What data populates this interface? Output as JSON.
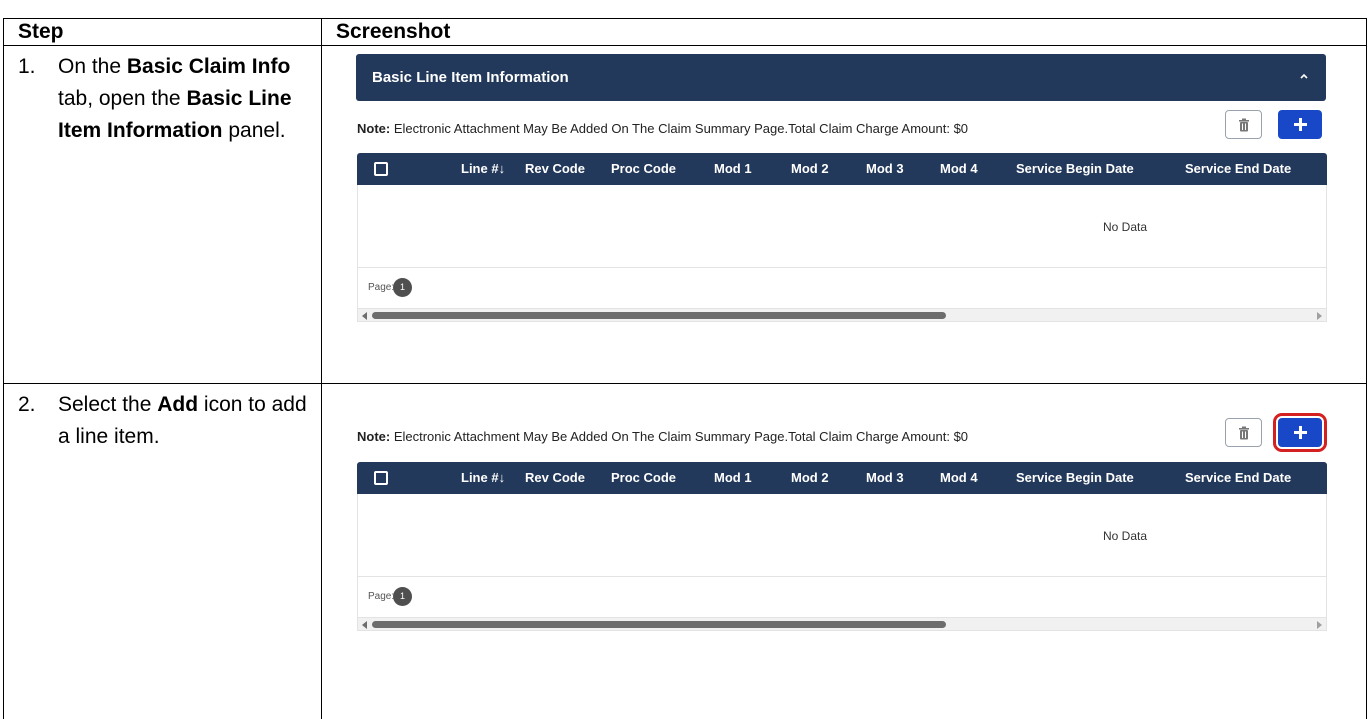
{
  "header": {
    "step": "Step",
    "screenshot": "Screenshot"
  },
  "steps": [
    {
      "num": "1.",
      "t1": "On the ",
      "b1": "Basic Claim Info",
      "t2": " tab, open the ",
      "b2": "Basic Line Item Information",
      "t3": " panel."
    },
    {
      "num": "2.",
      "t1": "Select the ",
      "b1": "Add",
      "t2": " icon to add a line item."
    }
  ],
  "panel": {
    "title": "Basic Line Item Information"
  },
  "note": {
    "label": "Note:",
    "text": " Electronic Attachment May Be Added On The Claim Summary Page.Total Claim Charge Amount: $0"
  },
  "grid": {
    "columns": [
      "Line #↓",
      "Rev Code",
      "Proc Code",
      "Mod 1",
      "Mod 2",
      "Mod 3",
      "Mod 4",
      "Service Begin Date",
      "Service End Date"
    ],
    "empty_text": "No Data"
  },
  "pager": {
    "label": "Page:",
    "current": "1"
  },
  "colors": {
    "header_bg": "#23395b",
    "add_button": "#1848c8",
    "highlight": "#d42020"
  },
  "icons": {
    "trash": "trash-icon",
    "add": "plus-icon",
    "caret": "chevron-up-icon"
  }
}
